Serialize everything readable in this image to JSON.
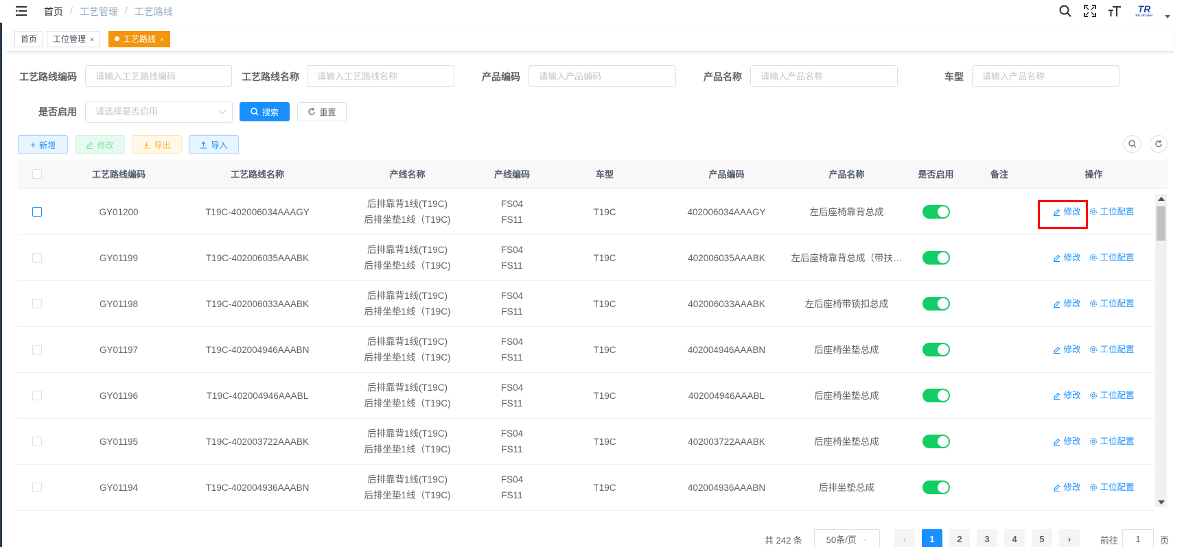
{
  "breadcrumb": [
    "首页",
    "工艺管理",
    "工艺路线"
  ],
  "header_icons": [
    "search-icon",
    "fullscreen-icon",
    "font-size-icon"
  ],
  "logo": {
    "main": "TR",
    "sub": "RETAIGER"
  },
  "tags": [
    {
      "label": "首页",
      "closable": false,
      "active": false
    },
    {
      "label": "工位管理",
      "closable": true,
      "active": false
    },
    {
      "label": "工艺路线",
      "closable": true,
      "active": true
    }
  ],
  "filters": {
    "route_code": {
      "label": "工艺路线编码",
      "placeholder": "请输入工艺路线编码"
    },
    "route_name": {
      "label": "工艺路线名称",
      "placeholder": "请输入工艺路线名称"
    },
    "product_code": {
      "label": "产品编码",
      "placeholder": "请输入产品编码"
    },
    "product_name": {
      "label": "产品名称",
      "placeholder": "请输入产品名称"
    },
    "car_model": {
      "label": "车型",
      "placeholder": "请输入产品名称"
    },
    "enabled": {
      "label": "是否启用",
      "placeholder": "请选择是否启用"
    },
    "search_btn": "搜索",
    "reset_btn": "重置"
  },
  "toolbar": {
    "add": "新增",
    "edit": "修改",
    "export": "导出",
    "import": "导入"
  },
  "table": {
    "columns": [
      "工艺路线编码",
      "工艺路线名称",
      "产线名称",
      "产线编码",
      "车型",
      "产品编码",
      "产品名称",
      "是否启用",
      "备注",
      "操作"
    ],
    "rows": [
      {
        "code": "GY01200",
        "name": "T19C-402006034AAAGY",
        "line1": "后排靠背1线(T19C)",
        "line2": "后排坐垫1线（T19C)",
        "lc1": "FS04",
        "lc2": "FS11",
        "car": "T19C",
        "pcode": "402006034AAAGY",
        "pname": "左后座椅靠背总成",
        "enabled": true,
        "remark": ""
      },
      {
        "code": "GY01199",
        "name": "T19C-402006035AAABK",
        "line1": "后排靠背1线(T19C)",
        "line2": "后排坐垫1线（T19C)",
        "lc1": "FS04",
        "lc2": "FS11",
        "car": "T19C",
        "pcode": "402006035AAABK",
        "pname": "左后座椅靠背总成（带扶…",
        "enabled": true,
        "remark": ""
      },
      {
        "code": "GY01198",
        "name": "T19C-402006033AAABK",
        "line1": "后排靠背1线(T19C)",
        "line2": "后排坐垫1线（T19C)",
        "lc1": "FS04",
        "lc2": "FS11",
        "car": "T19C",
        "pcode": "402006033AAABK",
        "pname": "左后座椅带锁扣总成",
        "enabled": true,
        "remark": ""
      },
      {
        "code": "GY01197",
        "name": "T19C-402004946AAABN",
        "line1": "后排靠背1线(T19C)",
        "line2": "后排坐垫1线（T19C)",
        "lc1": "FS04",
        "lc2": "FS11",
        "car": "T19C",
        "pcode": "402004946AAABN",
        "pname": "后座椅坐垫总成",
        "enabled": true,
        "remark": ""
      },
      {
        "code": "GY01196",
        "name": "T19C-402004946AAABL",
        "line1": "后排靠背1线(T19C)",
        "line2": "后排坐垫1线（T19C)",
        "lc1": "FS04",
        "lc2": "FS11",
        "car": "T19C",
        "pcode": "402004946AAABL",
        "pname": "后座椅坐垫总成",
        "enabled": true,
        "remark": ""
      },
      {
        "code": "GY01195",
        "name": "T19C-402003722AAABK",
        "line1": "后排靠背1线(T19C)",
        "line2": "后排坐垫1线（T19C)",
        "lc1": "FS04",
        "lc2": "FS11",
        "car": "T19C",
        "pcode": "402003722AAABK",
        "pname": "后座椅坐垫总成",
        "enabled": true,
        "remark": ""
      },
      {
        "code": "GY01194",
        "name": "T19C-402004936AAABN",
        "line1": "后排靠背1线(T19C)",
        "line2": "后排坐垫1线（T19C)",
        "lc1": "FS04",
        "lc2": "FS11",
        "car": "T19C",
        "pcode": "402004936AAABN",
        "pname": "后排坐垫总成",
        "enabled": true,
        "remark": ""
      }
    ],
    "op_edit": "修改",
    "op_config": "工位配置"
  },
  "pagination": {
    "total": "共 242 条",
    "page_size": "50条/页",
    "pages": [
      "1",
      "2",
      "3",
      "4",
      "5"
    ],
    "current": "1",
    "goto_label": "前往",
    "goto_value": "1",
    "page_suffix": "页"
  },
  "colors": {
    "primary": "#1890ff",
    "tag_active": "#f3960b",
    "switch_on": "#13ce66",
    "highlight": "#ff0000"
  }
}
